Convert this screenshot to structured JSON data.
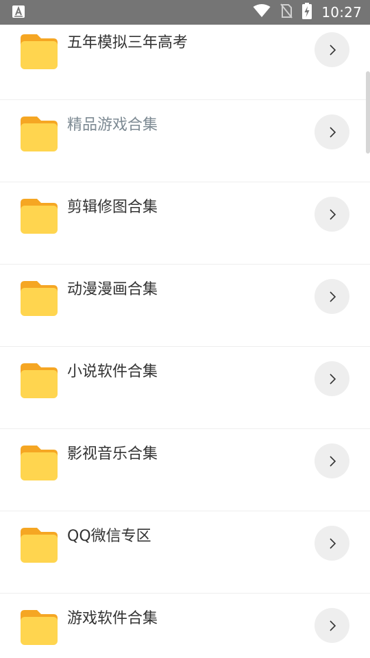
{
  "status_bar": {
    "time": "10:27",
    "icons": [
      "app-notification-icon",
      "wifi-icon",
      "no-sim-icon",
      "battery-charging-icon"
    ]
  },
  "list": {
    "items": [
      {
        "label": "五年模拟三年高考",
        "state": "normal"
      },
      {
        "label": "精品游戏合集",
        "state": "pressed"
      },
      {
        "label": "剪辑修图合集",
        "state": "normal"
      },
      {
        "label": "动漫漫画合集",
        "state": "normal"
      },
      {
        "label": "小说软件合集",
        "state": "normal"
      },
      {
        "label": "影视音乐合集",
        "state": "normal"
      },
      {
        "label": "QQ微信专区",
        "state": "normal"
      },
      {
        "label": "游戏软件合集",
        "state": "normal"
      }
    ]
  },
  "colors": {
    "status_bar": "#757575",
    "folder_back": "#f5a623",
    "folder_front": "#ffd54f",
    "arrow_bg": "#eeeeee",
    "label_text": "#333333",
    "label_muted": "#7d8a93"
  }
}
